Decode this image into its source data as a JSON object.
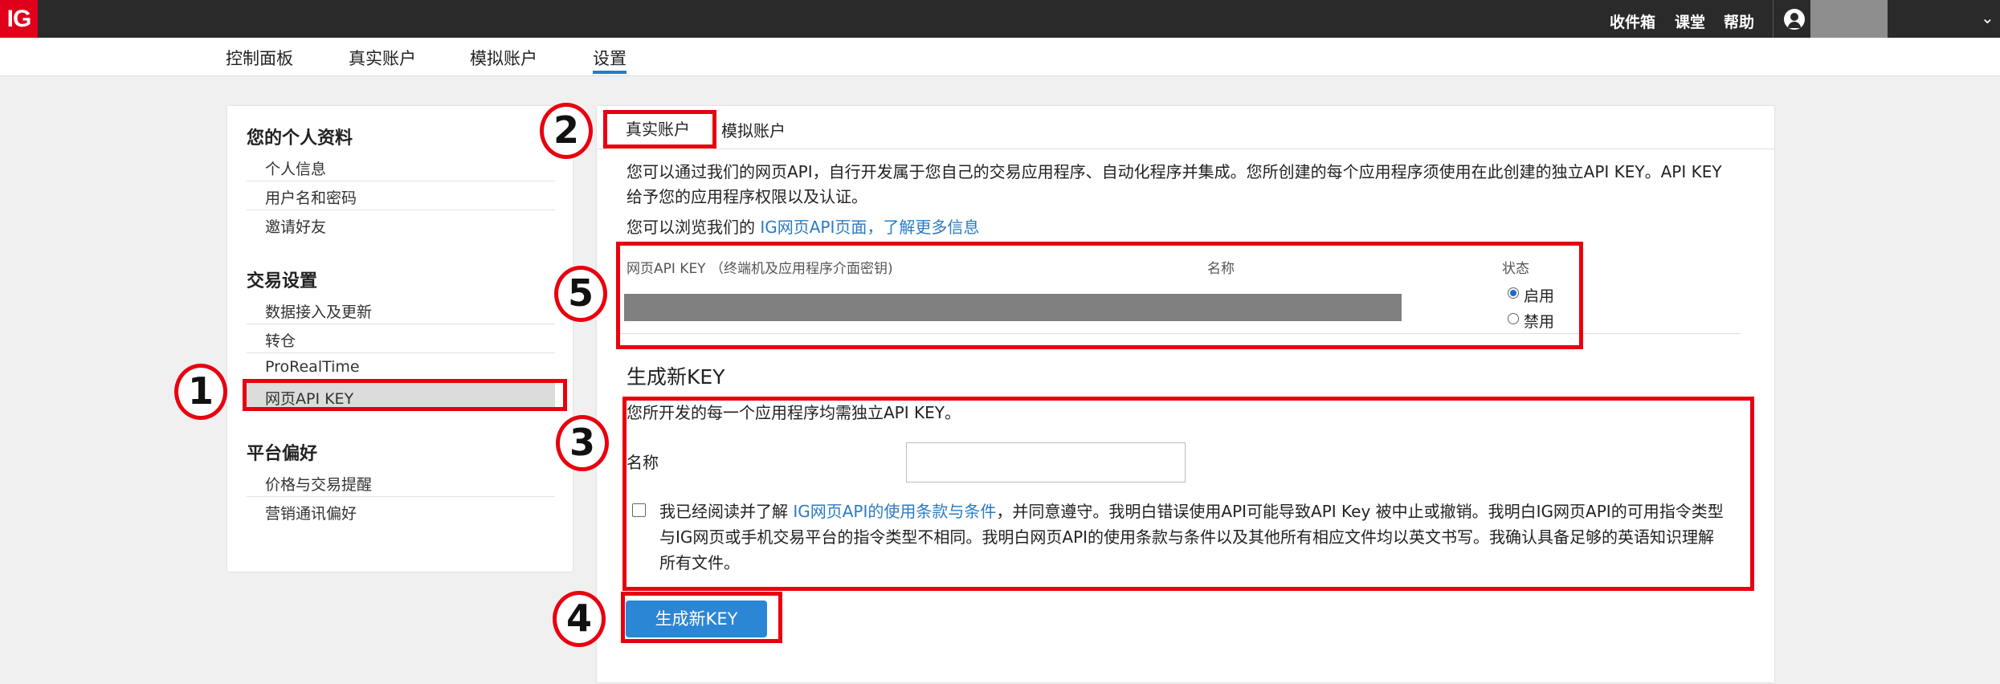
{
  "topbar": {
    "logo": "IG",
    "links": [
      "收件箱",
      "课堂",
      "帮助"
    ]
  },
  "nav": {
    "items": [
      "控制面板",
      "真实账户",
      "模拟账户",
      "设置"
    ],
    "active": "设置"
  },
  "sidebar": {
    "sections": [
      {
        "heading": "您的个人资料",
        "items": [
          "个人信息",
          "用户名和密码",
          "邀请好友"
        ]
      },
      {
        "heading": "交易设置",
        "items": [
          "数据接入及更新",
          "转仓",
          "ProRealTime",
          "网页API KEY"
        ]
      },
      {
        "heading": "平台偏好",
        "items": [
          "价格与交易提醒",
          "营销通讯偏好"
        ]
      }
    ],
    "active_item": "网页API KEY"
  },
  "main": {
    "tabs": [
      "真实账户",
      "模拟账户"
    ],
    "intro_line1": "您可以通过我们的网页API，自行开发属于您自己的交易应用程序、自动化程序并集成。您所创建的每个应用程序须使用在此创建的独立API KEY。API KEY",
    "intro_line2": "给予您的应用程序权限以及认证。",
    "browse_prefix": "您可以浏览我们的",
    "browse_link": "IG网页API页面，了解更多信息",
    "table": {
      "col_key": "网页API KEY （终端机及应用程序介面密钥)",
      "col_name": "名称",
      "col_status": "状态",
      "status_enabled": "启用",
      "status_disabled": "禁用",
      "selected_status": "启用"
    },
    "generate_heading": "生成新KEY",
    "generate_note": "您所开发的每一个应用程序均需独立API KEY。",
    "name_label": "名称",
    "name_value": "",
    "terms_prefix": "我已经阅读并了解",
    "terms_link": "IG网页API的使用条款与条件",
    "terms_rest1": "，并同意遵守。我明白错误使用API可能导致API Key 被中止或撤销。我明白IG网页API的可用指令类型",
    "terms_line2": "与IG网页或手机交易平台的指令类型不相同。我明白网页API的使用条款与条件以及其他所有相应文件均以英文书写。我确认具备足够的英语知识理解",
    "terms_line3": "所有文件。",
    "terms_checked": false,
    "generate_button": "生成新KEY"
  },
  "annotations": [
    "1",
    "2",
    "3",
    "4",
    "5"
  ],
  "colors": {
    "annotation_red": "#e8000f",
    "link_blue": "#2b7bc4",
    "button_blue": "#2b86d6",
    "brand_red": "#e0001b"
  }
}
